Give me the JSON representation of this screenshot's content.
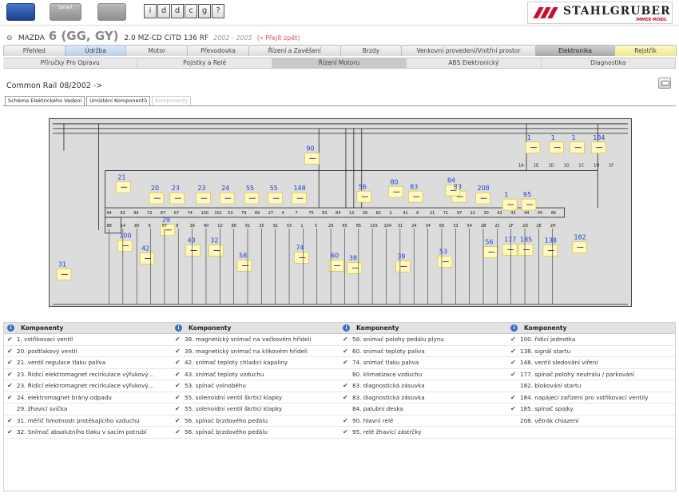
{
  "toolbar": {
    "car_label": "Smart",
    "icons": [
      "i",
      "d",
      "d",
      "c",
      "g",
      "?"
    ]
  },
  "logo": {
    "brand": "STAHLGRUBER",
    "tag": "IMMER MOBIL"
  },
  "vehicle": {
    "make": "MAZDA",
    "model": "6 (GG, GY)",
    "engine": "2.0 MZ-CD CiTD 136 RF",
    "years": "2002 - 2005",
    "back_link": "(« Přejít zpět)"
  },
  "tabs": [
    "Přehled",
    "Údržba",
    "Motor",
    "Převodovka",
    "Řízení a Zavěšení",
    "Brzdy",
    "Venkovní provedení/Vnitřní prostor",
    "Elektronika",
    "Rejstřík"
  ],
  "subtabs": [
    "Příručky Pro Opravu",
    "Pojistky a Relé",
    "Řízení Motoru",
    "ABS Elektronický",
    "Diagnostika"
  ],
  "section_title": "Common Rail 08/2002 ->",
  "diagram_tabs": [
    "Schéma Elektrického Vedení",
    "Umístění Komponentů",
    "Komponenty"
  ],
  "diagram": {
    "labels": [
      "90",
      "21",
      "20",
      "23",
      "23",
      "24",
      "55",
      "55",
      "148",
      "56",
      "80",
      "83",
      "83",
      "84",
      "208",
      "1",
      "1",
      "1",
      "1",
      "184",
      "95",
      "100",
      "29",
      "31",
      "42",
      "43",
      "32",
      "58",
      "74",
      "60",
      "38",
      "39",
      "53",
      "56",
      "177",
      "185",
      "138",
      "182"
    ],
    "pin_labels": [
      "94",
      "93",
      "99",
      "72",
      "87",
      "67",
      "74",
      "100",
      "101",
      "53",
      "79",
      "89",
      "27",
      "4",
      "7",
      "75",
      "83",
      "84",
      "13",
      "39",
      "82",
      "2",
      "41",
      "6",
      "21",
      "71",
      "97",
      "22",
      "30",
      "42",
      "43",
      "44",
      "45",
      "86",
      "88",
      "14",
      "80",
      "9",
      "87",
      "8",
      "36",
      "90",
      "10",
      "88",
      "61",
      "35",
      "91",
      "55",
      "1",
      "3",
      "29",
      "65",
      "85",
      "103",
      "104",
      "31",
      "24",
      "34",
      "66",
      "33",
      "54",
      "2B",
      "2C",
      "2F",
      "2D",
      "2E",
      "2H",
      "1A",
      "1E",
      "1D",
      "1G",
      "1C",
      "1H",
      "1F"
    ]
  },
  "components": {
    "header": "Komponenty",
    "columns": [
      [
        {
          "text": "1. vstřikovací ventil",
          "checked": true
        },
        {
          "text": "20. podtlakový ventil",
          "checked": true
        },
        {
          "text": "21. ventil regulace tlaku paliva",
          "checked": true
        },
        {
          "text": "23. Řídicí elektromagnet recirkulace výfukový…",
          "checked": true
        },
        {
          "text": "23. Řídicí elektromagnet recirkulace výfukový…",
          "checked": true
        },
        {
          "text": "24. elektromagnet brány odpadu",
          "checked": true
        },
        {
          "text": "29. žhavicí svíčka",
          "checked": false
        },
        {
          "text": "31. měřič hmotnosti protékajícího vzduchu",
          "checked": true
        },
        {
          "text": "32. Snímač absolutního tlaku v sacím potrubí",
          "checked": true
        }
      ],
      [
        {
          "text": "38. magnetický snímač na vačkovém hřídeli",
          "checked": true
        },
        {
          "text": "39. magnetický snímač na klikovém hřídeli",
          "checked": true
        },
        {
          "text": "42. snímač teploty chladicí kapaliny",
          "checked": true
        },
        {
          "text": "43. snímač teploty vzduchu",
          "checked": true
        },
        {
          "text": "53. spínač volnoběhu",
          "checked": true
        },
        {
          "text": "55. solenoidní ventil škrticí klapky",
          "checked": true
        },
        {
          "text": "55. solenoidní ventil škrticí klapky",
          "checked": true
        },
        {
          "text": "56. spínač brzdového pedálu",
          "checked": true
        },
        {
          "text": "56. spínač brzdového pedálu",
          "checked": true
        }
      ],
      [
        {
          "text": "58. snímač polohy pedálu plynu",
          "checked": true
        },
        {
          "text": "60. snímač teploty paliva",
          "checked": true
        },
        {
          "text": "74. snímač tlaku paliva",
          "checked": true
        },
        {
          "text": "80. klimatizace vzduchu",
          "checked": false
        },
        {
          "text": "83. diagnostická zásuvka",
          "checked": true
        },
        {
          "text": "83. diagnostická zásuvka",
          "checked": true
        },
        {
          "text": "84. palubní deska",
          "checked": false
        },
        {
          "text": "90. hlavní relé",
          "checked": true
        },
        {
          "text": "95. relé žhavicí zástrčky",
          "checked": true
        }
      ],
      [
        {
          "text": "100. řídicí jednotka",
          "checked": true
        },
        {
          "text": "138. signál startu",
          "checked": true
        },
        {
          "text": "148. ventil sledování víření",
          "checked": true
        },
        {
          "text": "177. spínač polohy neutrálu / parkování",
          "checked": true
        },
        {
          "text": "182. blokování startu",
          "checked": false
        },
        {
          "text": "184. napájecí zařízení pro vstřikovací ventily",
          "checked": true
        },
        {
          "text": "185. spínač spojky",
          "checked": true
        },
        {
          "text": "208. větrák chlazení",
          "checked": false
        },
        {
          "text": "",
          "checked": false
        }
      ]
    ]
  }
}
